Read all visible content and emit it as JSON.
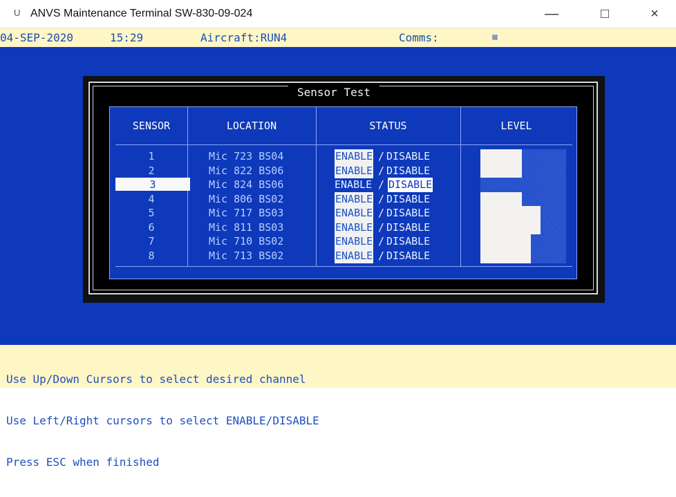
{
  "window": {
    "title": "ANVS Maintenance Terminal SW-830-09-024"
  },
  "status": {
    "date": "04-SEP-2020",
    "time": "15:29",
    "aircraft": "Aircraft:RUN4",
    "comms": "Comms:",
    "comms_icon": "⊠"
  },
  "dialog": {
    "title": "Sensor Test"
  },
  "table": {
    "headers": [
      "SENSOR",
      "LOCATION",
      "STATUS",
      "LEVEL"
    ],
    "rows": [
      {
        "sensor": "1",
        "location": "Mic 723 BS04",
        "status": "ENABLE/DISABLE",
        "selected": false,
        "disabled_selected": false,
        "level": 0.48
      },
      {
        "sensor": "2",
        "location": "Mic 822 BS06",
        "status": "ENABLE/DISABLE",
        "selected": false,
        "disabled_selected": false,
        "level": 0.48
      },
      {
        "sensor": "3",
        "location": "Mic 824 BS06",
        "status": "ENABLE/DISABLE",
        "selected": true,
        "disabled_selected": true,
        "level": 0.0
      },
      {
        "sensor": "4",
        "location": "Mic 806 BS02",
        "status": "ENABLE/DISABLE",
        "selected": false,
        "disabled_selected": false,
        "level": 0.48
      },
      {
        "sensor": "5",
        "location": "Mic 717 BS03",
        "status": "ENABLE/DISABLE",
        "selected": false,
        "disabled_selected": false,
        "level": 0.7
      },
      {
        "sensor": "6",
        "location": "Mic 811 BS03",
        "status": "ENABLE/DISABLE",
        "selected": false,
        "disabled_selected": false,
        "level": 0.7
      },
      {
        "sensor": "7",
        "location": "Mic 710 BS02",
        "status": "ENABLE/DISABLE",
        "selected": false,
        "disabled_selected": false,
        "level": 0.59
      },
      {
        "sensor": "8",
        "location": "Mic 713 BS02",
        "status": "ENABLE/DISABLE",
        "selected": false,
        "disabled_selected": false,
        "level": 0.59
      }
    ]
  },
  "instructions": [
    "Use Up/Down Cursors to select desired channel",
    "Use Left/Right cursors to select ENABLE/DISABLE",
    "Press ESC when finished"
  ]
}
